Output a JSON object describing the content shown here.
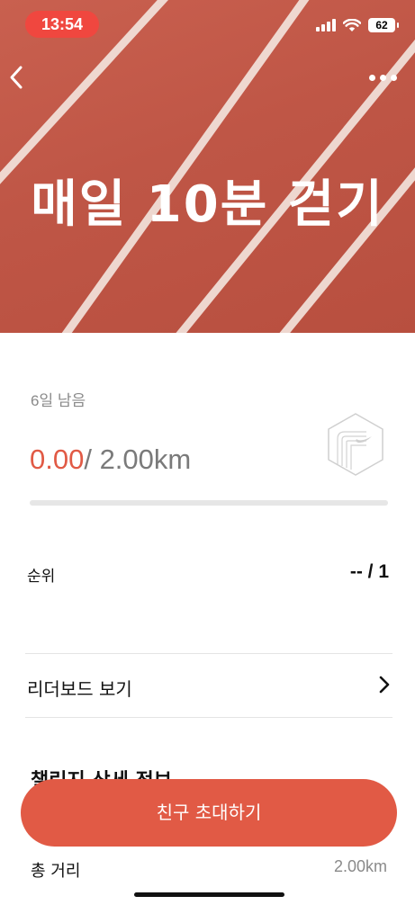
{
  "status_bar": {
    "time": "13:54",
    "battery": "62"
  },
  "header": {
    "back_icon": "chevron-left-icon",
    "more_icon": "more-dots-icon"
  },
  "hero": {
    "title": "매일 10분 걷기"
  },
  "challenge": {
    "remaining": "6일 남음",
    "current_distance": "0.00",
    "goal_distance": "/ 2.00km",
    "progress_fraction": 0,
    "badge_icon": "nike-track-badge-icon"
  },
  "rank": {
    "label": "순위",
    "value": "-- / 1"
  },
  "leaderboard": {
    "label": "리더보드 보기"
  },
  "details": {
    "title": "챌린지 상세 정보",
    "total_distance_label": "총 거리",
    "total_distance_value": "2.00km"
  },
  "invite_button": {
    "label": "친구 초대하기"
  },
  "colors": {
    "accent": "#e15a45",
    "hero_background": "#c05747",
    "status_pill": "#f0473f"
  }
}
